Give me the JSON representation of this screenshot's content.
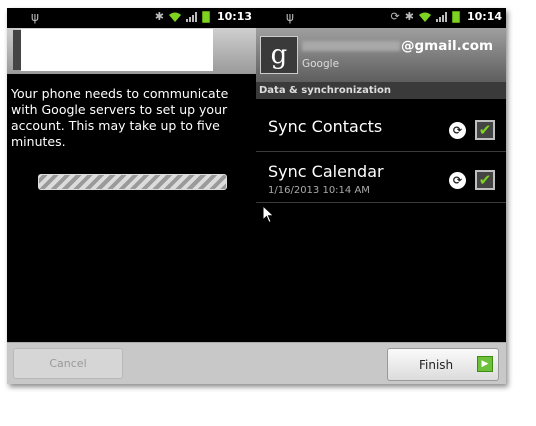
{
  "left_screen": {
    "status_time": "10:13",
    "message": "Your phone needs to communicate with Google servers to set up your account. This may take up to five minutes.",
    "cancel_label": "Cancel"
  },
  "right_screen": {
    "status_time": "10:14",
    "account": {
      "email_suffix": "@gmail.com",
      "provider": "Google",
      "logo_letter": "g"
    },
    "section_header": "Data & synchronization",
    "items": [
      {
        "title": "Sync Contacts",
        "checked": true
      },
      {
        "title": "Sync Calendar",
        "subtitle": "1/16/2013 10:14 AM",
        "checked": true
      }
    ],
    "finish_label": "Finish"
  },
  "colors": {
    "check_green": "#7ed321",
    "finish_arrow": "#6cc03a"
  },
  "icons": {
    "status": [
      "usb-icon",
      "bluetooth-icon",
      "wifi-icon",
      "signal-icon",
      "battery-icon",
      "sync-icon"
    ],
    "sync_button": "sync-icon",
    "checkbox": "checkmark-icon",
    "finish_arrow": "arrow-right-icon"
  }
}
